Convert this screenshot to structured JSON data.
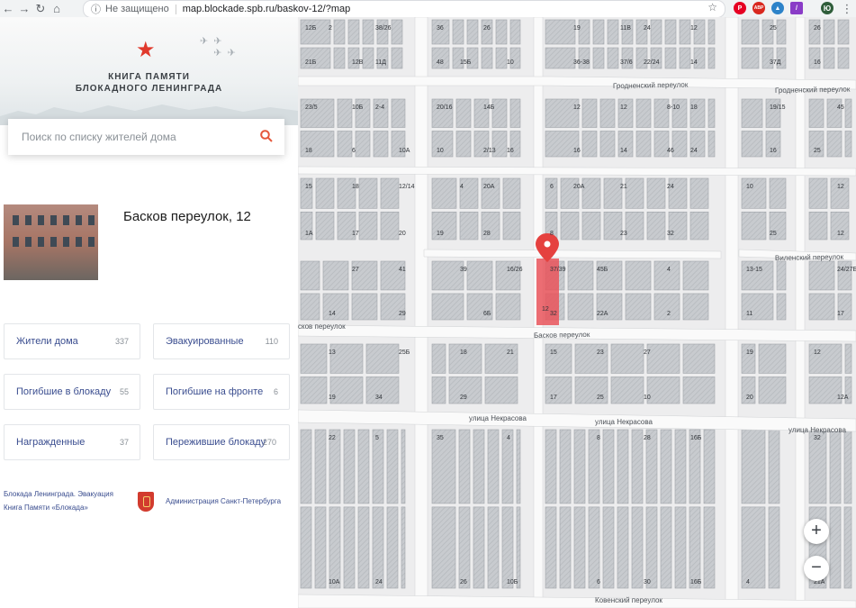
{
  "browser": {
    "security_text": "Не защищено",
    "url": "map.blockade.spb.ru/baskov-12/?map",
    "profile_initial": "Ю",
    "ext_badge": "ABP"
  },
  "header": {
    "title_line1": "КНИГА ПАМЯТИ",
    "title_line2": "БЛОКАДНОГО ЛЕНИНГРАДА"
  },
  "search": {
    "placeholder": "Поиск по списку жителей дома"
  },
  "house": {
    "address": "Басков переулок, 12"
  },
  "categories": [
    {
      "label": "Жители дома",
      "count": "337"
    },
    {
      "label": "Эвакуированные",
      "count": "110"
    },
    {
      "label": "Погибшие в блокаду",
      "count": "55"
    },
    {
      "label": "Погибшие на фронте",
      "count": "6"
    },
    {
      "label": "Награжденные",
      "count": "37"
    },
    {
      "label": "Пережившие блокаду",
      "count": "270"
    }
  ],
  "footer": {
    "link1": "Блокада Ленинграда. Эвакуация",
    "link2": "Книга Памяти «Блокада»",
    "admin": "Администрация Санкт-Петербурга"
  },
  "map": {
    "streets": [
      "Гродненский переулок",
      "Гродненский переулок",
      "Виленский переулок",
      "Басков переулок",
      "сков переулок",
      "улица Некрасова",
      "улица Некрасова",
      "улица Некрасова",
      "Ковенский переулок"
    ],
    "house_numbers": [
      "12Б",
      "12В",
      "48",
      "11В",
      "37/6",
      "37Д",
      "10Б",
      "10А",
      "2/13",
      "8-10",
      "46",
      "45",
      "12/14",
      "4",
      "6",
      "8",
      "10",
      "12",
      "14",
      "16/26",
      "45Б",
      "22А",
      "11",
      "13",
      "34",
      "29",
      "27",
      "10",
      "12",
      "5",
      "35",
      "10Б",
      "16Б",
      "16Б",
      "21А",
      "21Б",
      "26",
      "19",
      "36-38",
      "25",
      "23/5",
      "6",
      "10",
      "12",
      "14",
      "16",
      "18",
      "20",
      "28",
      "24",
      "32",
      "12",
      "41",
      "39",
      "37/39",
      "32",
      "13-15",
      "17",
      "19",
      "21",
      "23",
      "25",
      "20",
      "22",
      "24",
      "26",
      "28",
      "30",
      "32",
      "38/26",
      "36",
      "10",
      "12",
      "14",
      "16",
      "18",
      "14Б",
      "12",
      "16",
      "19/15",
      "15",
      "17",
      "19",
      "21",
      "23",
      "25",
      "27",
      "29",
      "6Б",
      "4",
      "2",
      "24/27Б",
      "25Б",
      "18",
      "15",
      "17",
      "19",
      "12А",
      "10А",
      "4",
      "8",
      "6",
      "4",
      "2",
      "11Д",
      "15Б",
      "24",
      "22/24",
      "26",
      "2-4",
      "20/16",
      "16",
      "18",
      "24",
      "25",
      "1А",
      "20А",
      "20А"
    ],
    "pin_house": "12",
    "zoom_in": "+",
    "zoom_out": "−"
  },
  "colors": {
    "accent_red": "#e0392c",
    "link_blue": "#3a4d8f",
    "highlight": "#e9545a"
  }
}
